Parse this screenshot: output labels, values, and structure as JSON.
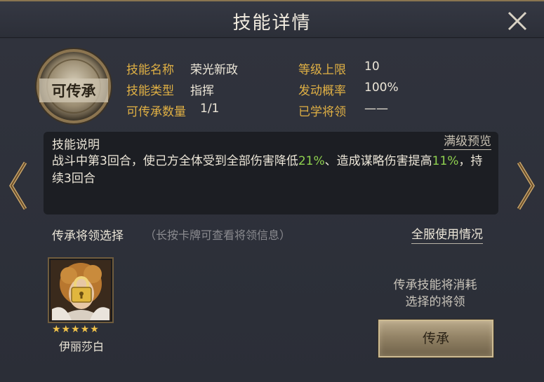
{
  "header": {
    "title": "技能详情"
  },
  "skill": {
    "badge_label": "可传承",
    "name_label": "技能名称",
    "name_value": "荣光新政",
    "type_label": "技能类型",
    "type_value": "指挥",
    "inherit_count_label": "可传承数量",
    "inherit_count_value": "1/1",
    "level_cap_label": "等级上限",
    "level_cap_value": "10",
    "trigger_rate_label": "发动概率",
    "trigger_rate_value": "100%",
    "learned_label": "已学将领",
    "learned_value": "——"
  },
  "description": {
    "title": "技能说明",
    "preview_link": "满级预览",
    "text_1": "战斗中第3回合，使己方全体受到全部伤害降低",
    "value_1": "21%",
    "text_2": "、造成谋略伤害提高",
    "value_2": "11%",
    "text_3": "，持续3回合"
  },
  "selection": {
    "label": "传承将领选择",
    "hint": "（长按卡牌可查看将领信息）",
    "server_link": "全服使用情况"
  },
  "hero_card": {
    "stars": "★★★★★",
    "name": "伊丽莎白"
  },
  "consume_note_line1": "传承技能将消耗",
  "consume_note_line2": "选择的将领",
  "inherit_button": "传承",
  "colors": {
    "accent_gold": "#e0b044",
    "highlight_green": "#8fd14f"
  }
}
